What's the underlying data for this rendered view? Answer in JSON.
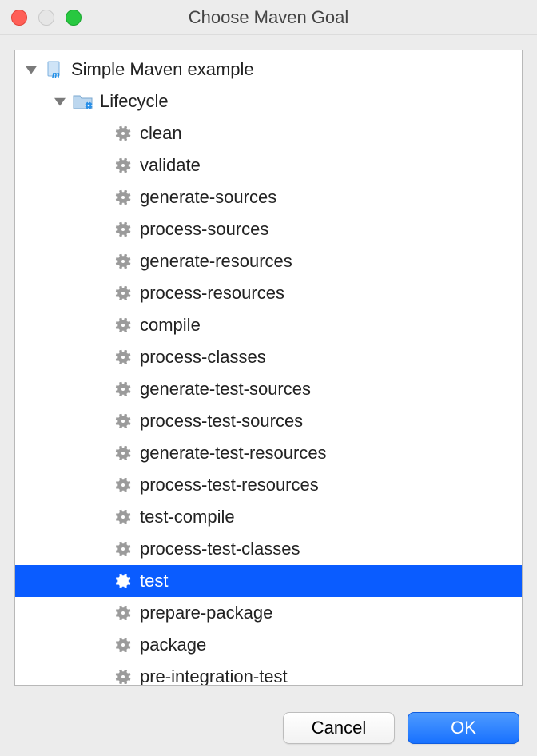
{
  "window": {
    "title": "Choose Maven Goal"
  },
  "project": {
    "label": "Simple Maven example"
  },
  "lifecycle": {
    "label": "Lifecycle",
    "goals": [
      {
        "label": "clean",
        "selected": false
      },
      {
        "label": "validate",
        "selected": false
      },
      {
        "label": "generate-sources",
        "selected": false
      },
      {
        "label": "process-sources",
        "selected": false
      },
      {
        "label": "generate-resources",
        "selected": false
      },
      {
        "label": "process-resources",
        "selected": false
      },
      {
        "label": "compile",
        "selected": false
      },
      {
        "label": "process-classes",
        "selected": false
      },
      {
        "label": "generate-test-sources",
        "selected": false
      },
      {
        "label": "process-test-sources",
        "selected": false
      },
      {
        "label": "generate-test-resources",
        "selected": false
      },
      {
        "label": "process-test-resources",
        "selected": false
      },
      {
        "label": "test-compile",
        "selected": false
      },
      {
        "label": "process-test-classes",
        "selected": false
      },
      {
        "label": "test",
        "selected": true
      },
      {
        "label": "prepare-package",
        "selected": false
      },
      {
        "label": "package",
        "selected": false
      },
      {
        "label": "pre-integration-test",
        "selected": false
      }
    ]
  },
  "buttons": {
    "cancel": "Cancel",
    "ok": "OK"
  }
}
